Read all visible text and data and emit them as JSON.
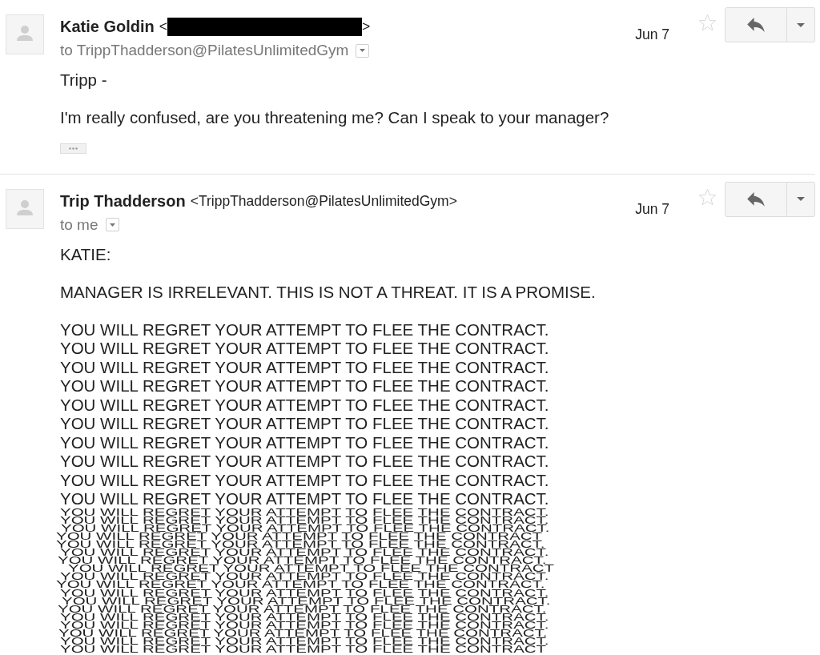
{
  "messages": [
    {
      "sender_name": "Katie Goldin",
      "sender_address": [
        {
          "kind": "text",
          "text": "<"
        },
        {
          "kind": "redacted"
        },
        {
          "kind": "text",
          "text": ">"
        }
      ],
      "recipient": "to TrippThadderson@PilatesUnlimitedGym",
      "date": "Jun 7",
      "starred": false,
      "body": [
        {
          "kind": "text",
          "lines": [
            "Tripp -"
          ]
        },
        {
          "kind": "text",
          "lines": [
            "I'm really confused, are you threatening me? Can I speak to your manager?"
          ]
        }
      ],
      "trimmed_content": true
    },
    {
      "sender_name": "Trip Thadderson",
      "sender_address": [
        {
          "kind": "text",
          "text": "<TrippThadderson@PilatesUnlimitedGym>"
        }
      ],
      "recipient": "to me",
      "date": "Jun 7",
      "starred": false,
      "body": [
        {
          "kind": "text",
          "lines": [
            "KATIE:"
          ]
        },
        {
          "kind": "text",
          "lines": [
            "MANAGER IS IRRELEVANT. THIS IS NOT A THREAT. IT IS A PROMISE."
          ]
        },
        {
          "kind": "text",
          "lines": [
            "YOU WILL REGRET YOUR ATTEMPT TO FLEE THE CONTRACT.",
            "YOU WILL REGRET YOUR ATTEMPT TO FLEE THE CONTRACT.",
            "YOU WILL REGRET YOUR ATTEMPT TO FLEE THE CONTRACT.",
            "YOU WILL REGRET YOUR ATTEMPT TO FLEE THE CONTRACT.",
            "YOU WILL REGRET YOUR ATTEMPT TO FLEE THE CONTRACT.",
            "YOU WILL REGRET YOUR ATTEMPT TO FLEE THE CONTRACT.",
            "YOU WILL REGRET YOUR ATTEMPT TO FLEE THE CONTRACT.",
            "YOU WILL REGRET YOUR ATTEMPT TO FLEE THE CONTRACT.",
            "YOU WILL REGRET YOUR ATTEMPT TO FLEE THE CONTRACT.",
            "YOU WILL REGRET YOUR ATTEMPT TO FLEE THE CONTRACT."
          ]
        },
        {
          "kind": "crowded",
          "lines": [
            "YOU WILL REGRET YOUR ATTEMPT TO FLEE THE CONTRACT.",
            "YOU WILL REGRET YOUR ATTEMPT TO FLEE THE CONTRACT.",
            "YOU WILL REGRET YOUR ATTEMPT TO FLEE THE CONTRACT.",
            "YOU WILL REGRET YOUR ATTEMPT TO FLEE THE CONTRACT",
            "YOU WILL REGRET YOUR ATTEMPT TO FLEE THE CONTRACT.",
            "YOU WILL REGRET YOUR ATTEMPT TO FLEE THE CONTRACT.",
            "YOU WILL REGRET YOUR ATTEMPT TO FLEE THE CONTRACT.",
            "YOU WILL REGRET YOUR ATTEMPT TO FLEE THE CONTRACT",
            "YOU WILL REGRET YOUR ATTEMPT TO FLEE THE CONTRACT.",
            "YOU WILL REGRET YOUR ATTEMPT TO FLEE THE CONTRACT.",
            "YOU WILL REGRET YOUR ATTEMPT TO FLEE THE CONTRACT.",
            "YOU WILL REGRET YOUR ATTEMPT TO FLEE THE CONTRACT.",
            "YOU WILL REGRET YOUR ATTEMPT TO FLEE THE CONTRACT.",
            "YOU WILL REGRET YOUR ATTEMPT TO FLEE THE CONTRACT.",
            "YOU WILL REGRET YOUR ATTEMPT TO FLEE THE CONTRACT.",
            "YOU WILL REGRET YOUR ATTEMPT TO FLEE THE CONTRACT.",
            "YOU WILL REGRET YOUR ATTEMPT TO FLEE THE CONTRACT.",
            "YOU WILL REGRET YOUR ATTEMPT TO FLEE THE CONTRACT"
          ]
        }
      ],
      "trimmed_content": false
    }
  ]
}
